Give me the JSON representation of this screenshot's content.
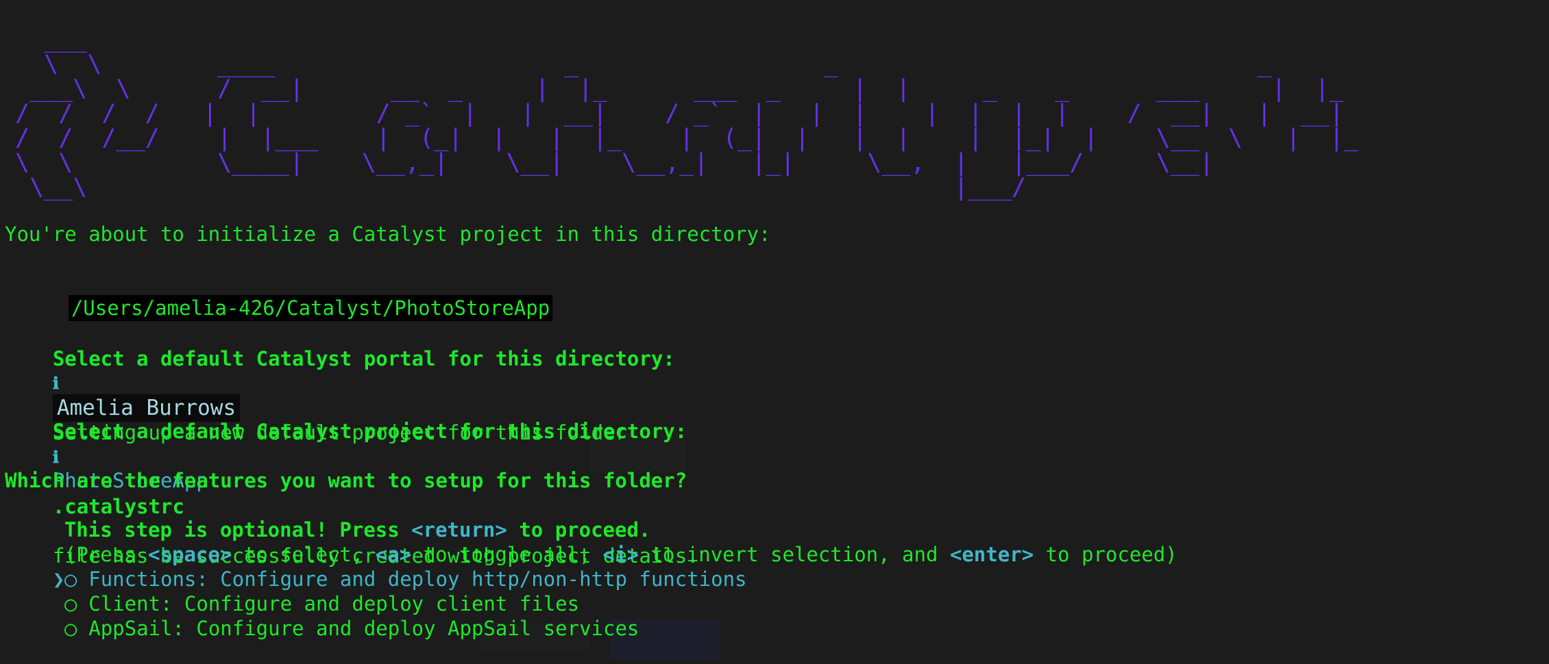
{
  "logo": {
    "ascii": "  ___\n  \\  \\        ____                    _                 _                             _\n ___\\  \\      /  __|      __  _     |  |_      ___  _     |  |     _    _      ___     |  |_\n/  /  /  /   |  |        / _`  |   |  __|    / _`  |   |  |    |  |  |  |    /  __|   |  __|\n/  /  /__/    |  |___    |  (_|  |   |  |_    |  (_|  |   |  |    |  |_|  |    \\__  \\   |  |_\n\\  \\          \\____|    \\__,_|    \\__|    \\__,_|   |_|     \\__,  |   |___/     \\__|\n \\__\\                                                            |___/"
  },
  "intro": "You're about to initialize a Catalyst project in this directory:",
  "path": "/Users/amelia-426/Catalyst/PhotoStoreApp",
  "portal_prompt": {
    "question": "Select a default Catalyst portal for this directory:",
    "answer": "Amelia Burrows"
  },
  "info_project": {
    "icon": "ℹ",
    "text": "Setting up a new default project for this folder"
  },
  "project_prompt": {
    "question": "Select a default Catalyst project for this directory:",
    "answer": "PhotoStoreApp"
  },
  "info_rc": {
    "icon": "ℹ",
    "file": ".catalystrc",
    "text": "file has be successfully created with project details."
  },
  "features_prompt": {
    "question": "Which are the features you want to setup for this folder?",
    "optional_pre": "This step is optional! Press ",
    "optional_key": "<return>",
    "optional_post": " to proceed.",
    "help_1": "(Press ",
    "key_space": "<space>",
    "help_2": " to select, ",
    "key_a": "<a>",
    "help_3": " to toggle all, ",
    "key_i": "<i>",
    "help_4": " to invert selection, and ",
    "key_enter": "<enter>",
    "help_5": " to proceed)"
  },
  "choices": [
    {
      "pointer": "❯",
      "circle": "◯",
      "label": "Functions: Configure and deploy http/non-http functions"
    },
    {
      "pointer": " ",
      "circle": "◯",
      "label": "Client: Configure and deploy client files"
    },
    {
      "pointer": " ",
      "circle": "◯",
      "label": "AppSail: Configure and deploy AppSail services"
    }
  ],
  "colors": {
    "background": "#1c1c1c",
    "text_green": "#1ee82a",
    "logo_purple": "#6232e8",
    "accent_cyan": "#3fb6c8"
  }
}
